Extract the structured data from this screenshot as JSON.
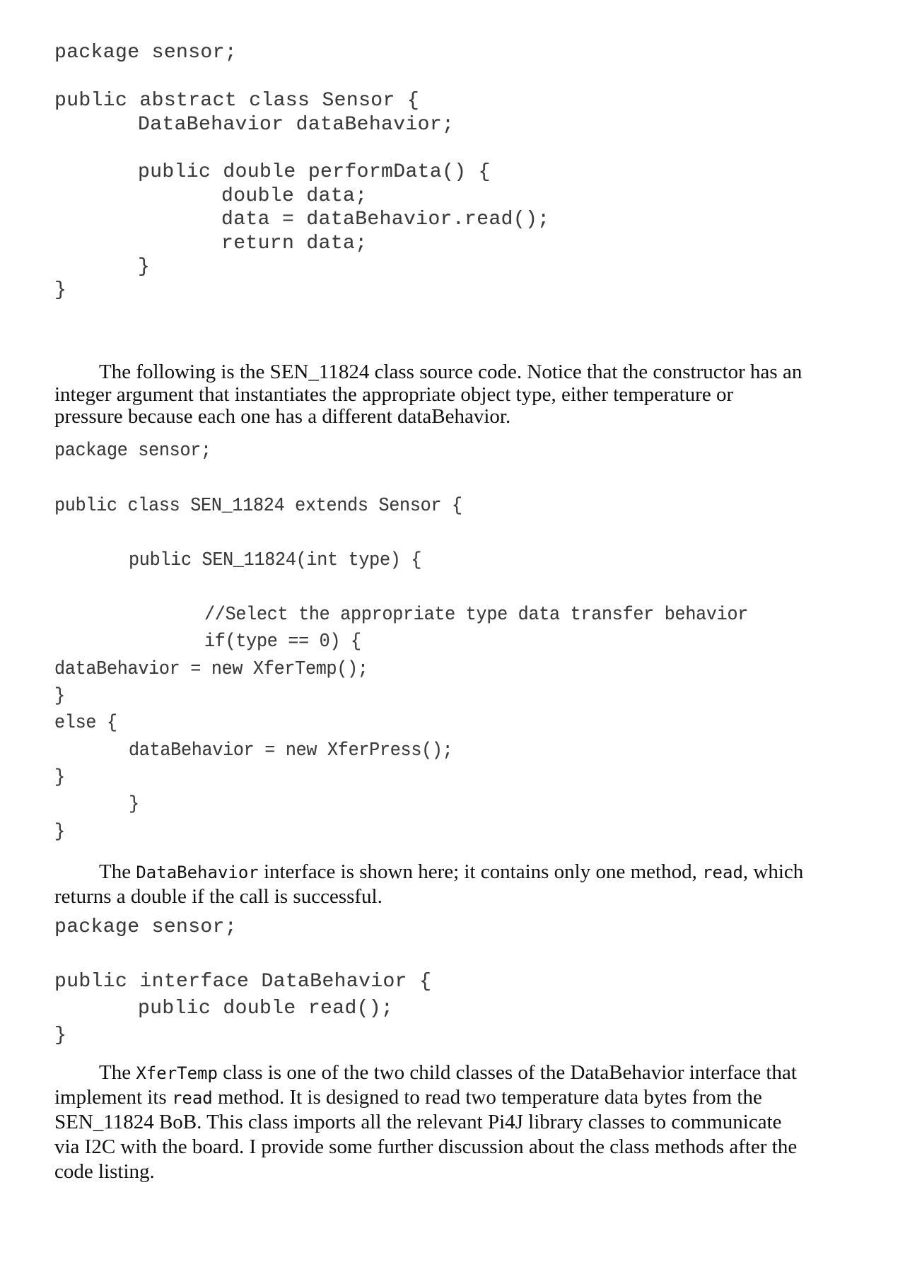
{
  "code_block_1": {
    "lines": [
      "package sensor;",
      "public abstract class Sensor {",
      "DataBehavior dataBehavior;",
      "public double performData() {",
      "double data;",
      "data = dataBehavior.read();",
      "return data;",
      "}",
      "}"
    ]
  },
  "paragraph_1": {
    "lines": [
      "The following is the SEN_11824 class source code. Notice that the constructor has an",
      "integer argument that instantiates the appropriate object type, either temperature or",
      "pressure because each one has a different dataBehavior."
    ]
  },
  "code_block_2": {
    "lines": [
      "package sensor;",
      "public class SEN_11824 extends Sensor {",
      "public SEN_11824(int type) {",
      "//Select the appropriate type data transfer behavior",
      "if(type == 0) {",
      "dataBehavior = new XferTemp();",
      "}",
      "else {",
      "dataBehavior = new XferPress();",
      "}",
      "}",
      "}"
    ]
  },
  "paragraph_2": {
    "line1_before": "The ",
    "line1_code": "DataBehavior",
    "line1_middle": " interface is shown here; it contains only one method, ",
    "line1_code2": "read",
    "line1_after": ", which",
    "line2": "returns a double if the call is successful."
  },
  "code_block_3": {
    "lines": [
      "package sensor;",
      "public interface DataBehavior {",
      "public double read();",
      "}"
    ]
  },
  "paragraph_3": {
    "line1_before": "The ",
    "line1_code": "XferTemp",
    "line1_after": " class is one of the two child classes of the DataBehavior interface that",
    "line2_before": "implement its ",
    "line2_code": "read",
    "line2_after": " method. It is designed to read two temperature data bytes from the",
    "line3": "SEN_11824 BoB. This class imports all the relevant Pi4J library classes to communicate",
    "line4": "via I2C with the board. I provide some further discussion about the class methods after the",
    "line5": "code listing."
  }
}
